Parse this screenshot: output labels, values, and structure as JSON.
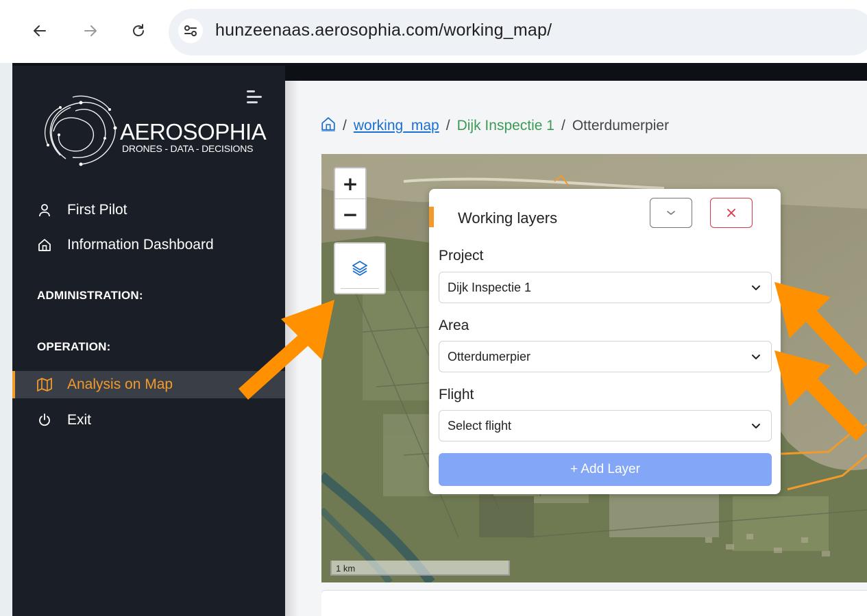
{
  "browser": {
    "url": "hunzeenaas.aerosophia.com/working_map/"
  },
  "sidebar": {
    "logo_title": "AEROSOPHIA",
    "logo_subtitle": "DRONES - DATA - DECISIONS",
    "items": [
      {
        "label": "First Pilot",
        "icon": "user-icon"
      },
      {
        "label": "Information Dashboard",
        "icon": "home-icon"
      }
    ],
    "sections": {
      "administration": "ADMINISTRATION:",
      "operation": "OPERATION:"
    },
    "operation_items": [
      {
        "label": "Analysis on Map",
        "icon": "map-icon",
        "active": true
      },
      {
        "label": "Exit",
        "icon": "power-icon"
      }
    ]
  },
  "breadcrumb": {
    "home_icon": "home-icon",
    "separator": "/",
    "working_map": "working_map",
    "project": "Dijk Inspectie 1",
    "area": "Otterdumerpier"
  },
  "map": {
    "scale_label": "1 km"
  },
  "panel": {
    "title": "Working layers",
    "project_label": "Project",
    "project_value": "Dijk Inspectie 1",
    "area_label": "Area",
    "area_value": "Otterdumerpier",
    "flight_label": "Flight",
    "flight_value": "Select flight",
    "add_layer": "+ Add Layer"
  },
  "colors": {
    "accent": "#f39a2b",
    "sidebar_bg": "#1a1e26",
    "link": "#1a6fd1",
    "breadcrumb_green": "#3c9a53",
    "add_button": "#83a7f6",
    "close_red": "#dc3545",
    "annotation_arrow": "#ff9100"
  }
}
